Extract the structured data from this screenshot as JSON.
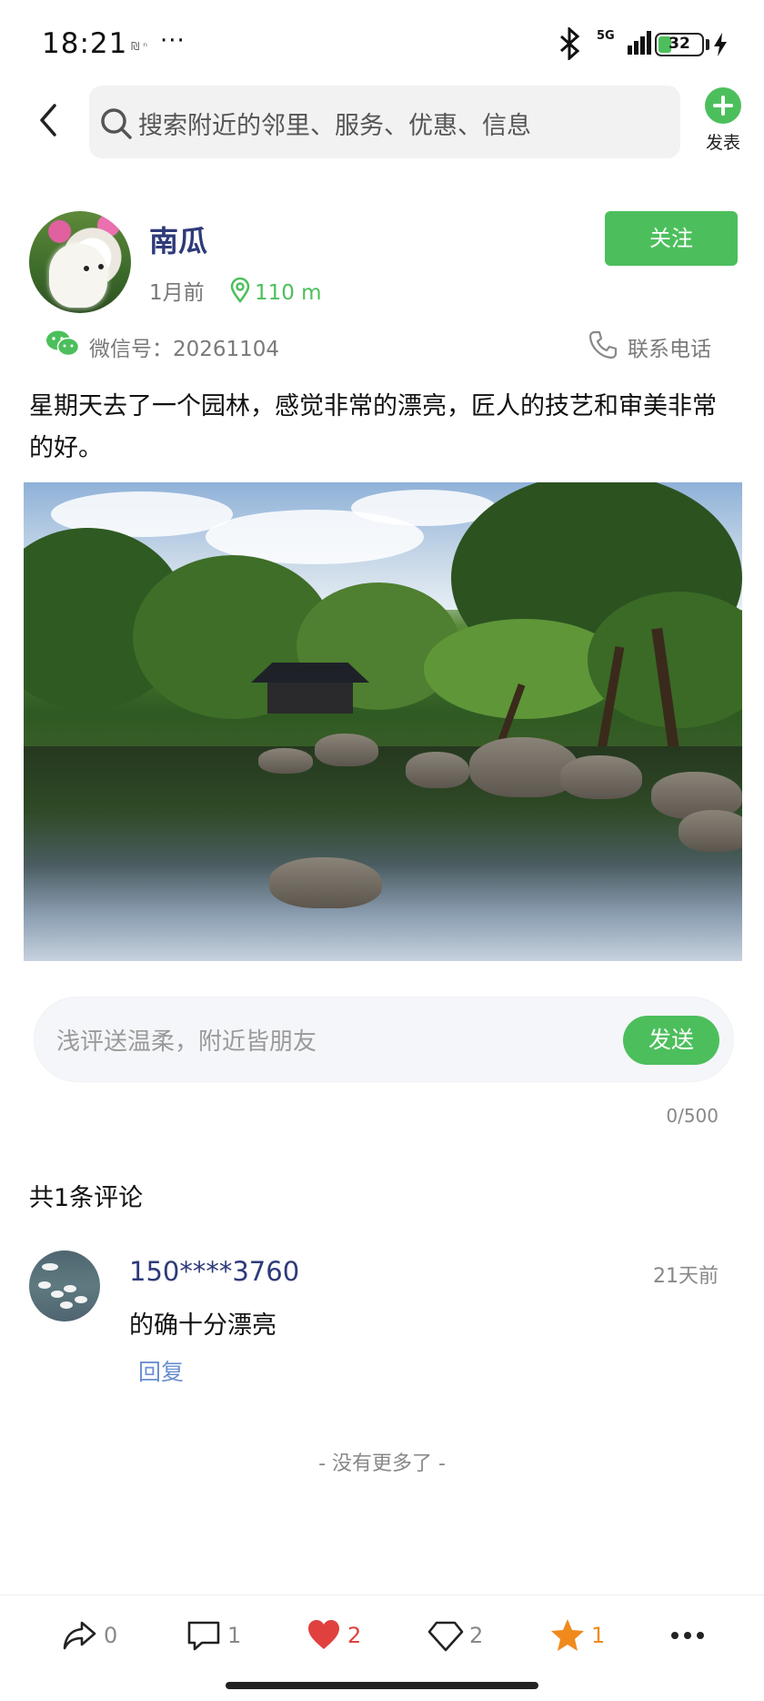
{
  "status_bar": {
    "time": "18:21",
    "extra_icons": "₪ ⁿ",
    "more": "···",
    "network": "5G",
    "battery": "32"
  },
  "search": {
    "placeholder": "搜索附近的邻里、服务、优惠、信息",
    "publish_label": "发表"
  },
  "post": {
    "author": "南瓜",
    "time_ago": "1月前",
    "distance": "110 m",
    "follow_label": "关注",
    "wechat": "微信号：20261104",
    "contact_label": "联系电话",
    "text": "星期天去了一个园林，感觉非常的漂亮，匠人的技艺和审美非常的好。"
  },
  "comment_input": {
    "placeholder": "浅评送温柔，附近皆朋友",
    "send_label": "发送",
    "counter": "0/500"
  },
  "comments": {
    "count_label": "共1条评论",
    "items": [
      {
        "user": "150****3760",
        "time": "21天前",
        "text": "的确十分漂亮",
        "reply_label": "回复"
      }
    ],
    "end_label": "- 没有更多了 -"
  },
  "actions": {
    "share": "0",
    "comment": "1",
    "like": "2",
    "diamond": "2",
    "star": "1"
  },
  "colors": {
    "accent_green": "#4cbf5c",
    "name_blue": "#2e3a7a",
    "like_red": "#e0413f",
    "star_orange": "#f08a1c",
    "reply_blue": "#6a8fd0"
  },
  "icons": [
    "back-arrow-icon",
    "search-icon",
    "plus-circle-icon",
    "location-pin-icon",
    "wechat-icon",
    "phone-icon",
    "share-icon",
    "comment-icon",
    "heart-icon",
    "diamond-icon",
    "star-icon",
    "more-icon",
    "bluetooth-icon",
    "battery-icon",
    "charging-icon"
  ]
}
